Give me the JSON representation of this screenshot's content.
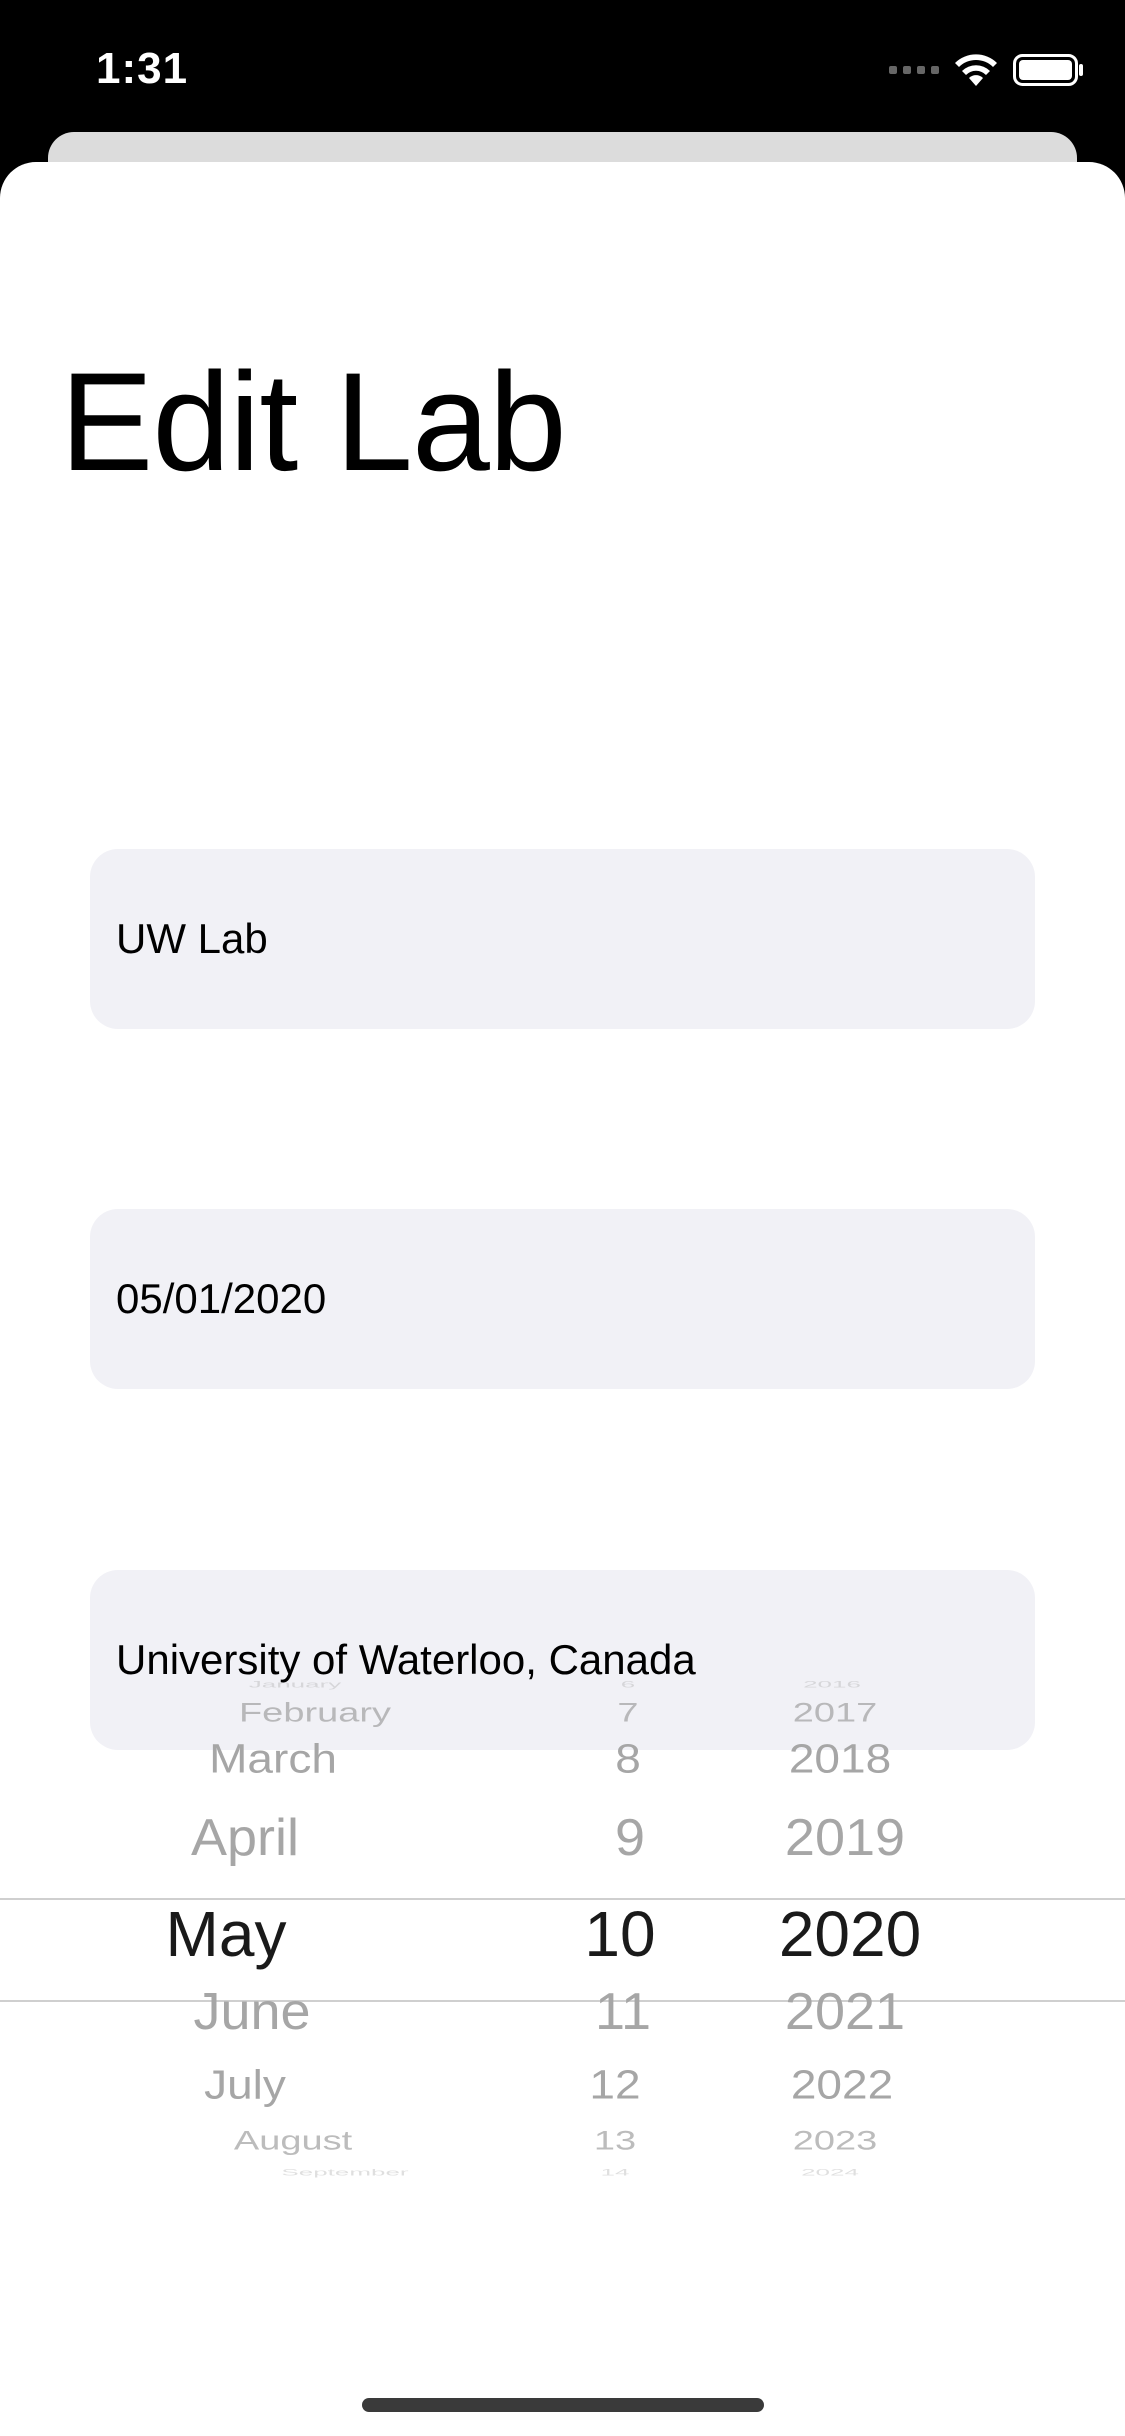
{
  "status_bar": {
    "time": "1:31",
    "icons": [
      "cellular-signal-icon",
      "wifi-icon",
      "battery-icon"
    ]
  },
  "page": {
    "title": "Edit Lab"
  },
  "form": {
    "name_value": "UW Lab",
    "date_value": "05/01/2020",
    "location_value": "University of Waterloo, Canada"
  },
  "picker": {
    "months": [
      "January",
      "February",
      "March",
      "April",
      "May",
      "June",
      "July",
      "August",
      "September"
    ],
    "days": [
      "6",
      "7",
      "8",
      "9",
      "10",
      "11",
      "12",
      "13",
      "14"
    ],
    "years": [
      "2016",
      "2017",
      "2018",
      "2019",
      "2020",
      "2021",
      "2022",
      "2023",
      "2024"
    ],
    "selected_month": "May",
    "selected_day": "10",
    "selected_year": "2020"
  },
  "colors": {
    "field_background": "#f1f1f6",
    "selected_text": "#1a1a1a",
    "unselected_text": "#a6a6a6"
  }
}
